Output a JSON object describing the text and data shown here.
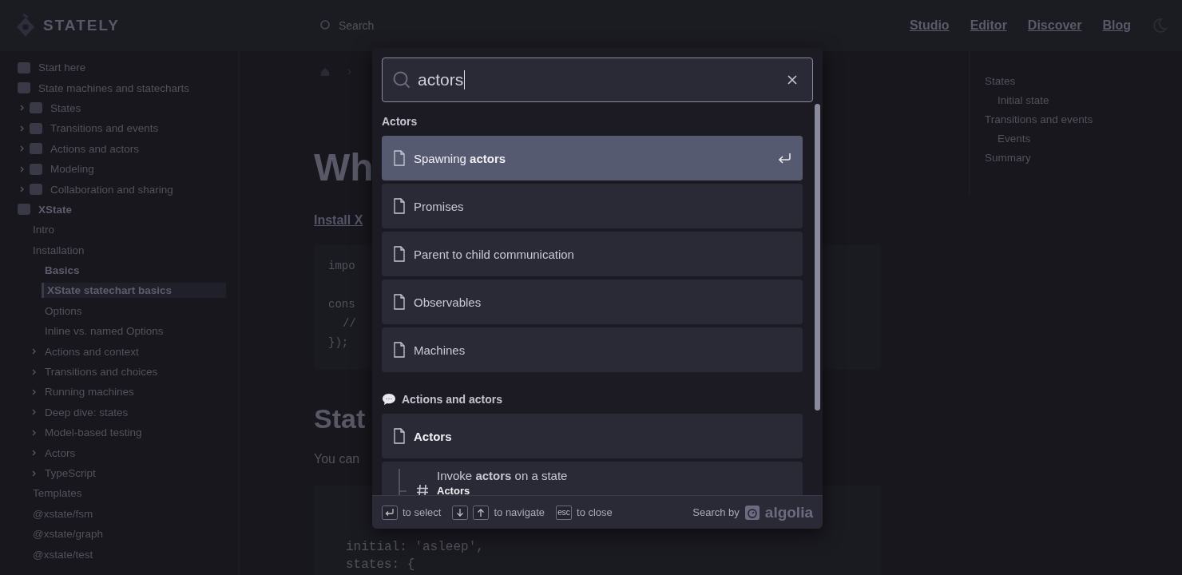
{
  "header": {
    "logo": "STATELY",
    "search_placeholder": "Search",
    "nav": [
      "Studio",
      "Editor",
      "Discover",
      "Blog"
    ]
  },
  "sidebar": {
    "items": [
      {
        "label": "Start here",
        "kind": "section",
        "selected": false
      },
      {
        "label": "State machines and statecharts",
        "kind": "section",
        "selected": false,
        "children": [
          {
            "label": "States",
            "kind": "section",
            "selected": false,
            "expanded": false
          },
          {
            "label": "Transitions and events",
            "kind": "section",
            "selected": false,
            "expanded": false
          },
          {
            "label": "Actions and actors",
            "kind": "section",
            "selected": false,
            "expanded": false
          },
          {
            "label": "Modeling",
            "kind": "section",
            "selected": false,
            "expanded": false
          },
          {
            "label": "Collaboration and sharing",
            "kind": "section",
            "selected": false,
            "expanded": false
          }
        ]
      },
      {
        "label": "XState",
        "kind": "section",
        "selected": false,
        "bold": true,
        "children": [
          {
            "label": "Intro",
            "selected": false
          },
          {
            "label": "Installation",
            "selected": false,
            "children": [
              {
                "label": "Basics",
                "selected": false,
                "bold": true
              },
              {
                "label": "XState statechart basics",
                "selected": true,
                "bold": true
              },
              {
                "label": "Options",
                "selected": false
              },
              {
                "label": "Inline vs. named Options",
                "selected": false
              },
              {
                "label": "Actions and context",
                "selected": false,
                "expanded": false
              },
              {
                "label": "Transitions and choices",
                "selected": false,
                "expanded": false
              },
              {
                "label": "Running machines",
                "selected": false,
                "expanded": false
              },
              {
                "label": "Deep dive: states",
                "selected": false,
                "expanded": false
              },
              {
                "label": "Model-based testing",
                "selected": false,
                "expanded": false
              },
              {
                "label": "Actors",
                "selected": false,
                "expanded": false
              },
              {
                "label": "TypeScript",
                "selected": false,
                "expanded": false
              }
            ]
          },
          {
            "label": "Templates",
            "selected": false
          },
          {
            "label": "@xstate/fsm",
            "selected": false
          },
          {
            "label": "@xstate/graph",
            "selected": false
          },
          {
            "label": "@xstate/test",
            "selected": false
          }
        ]
      }
    ]
  },
  "main": {
    "heading": "Wh",
    "link": "Install X",
    "code_1": [
      "impo",
      "cons",
      "//",
      "});"
    ],
    "heading_2": "Stat",
    "paragraph": "You can",
    "code_2": [
      "initial: 'asleep',",
      "states: {"
    ]
  },
  "toc": [
    {
      "label": "States",
      "children": [
        {
          "label": "Initial state"
        }
      ]
    },
    {
      "label": "Transitions and events",
      "children": [
        {
          "label": "Events"
        }
      ]
    },
    {
      "label": "Summary"
    }
  ],
  "search_modal": {
    "query": "actors",
    "sections": [
      {
        "title": "Actors",
        "hits": [
          {
            "kind": "page",
            "title": "Spawning **actors**",
            "selected": true
          },
          {
            "kind": "page",
            "title": "Promises",
            "selected": false
          },
          {
            "kind": "page",
            "title": "Parent to child communication",
            "selected": false
          },
          {
            "kind": "page",
            "title": "Observables",
            "selected": false
          },
          {
            "kind": "page",
            "title": "Machines",
            "selected": false
          }
        ]
      },
      {
        "title": "Actions and actors",
        "kind": "category",
        "hits": [
          {
            "kind": "page",
            "title": "Actors",
            "bold": true,
            "selected": false
          },
          {
            "kind": "heading",
            "title": "Invoke **actors** on a state",
            "subtitle": "Actors",
            "selected": false
          }
        ]
      }
    ],
    "footer": {
      "hints": [
        {
          "keys": [
            {
              "kind": "enter"
            }
          ],
          "label": "to select"
        },
        {
          "keys": [
            {
              "kind": "down"
            },
            {
              "kind": "up"
            }
          ],
          "label": "to navigate"
        },
        {
          "keys": [
            {
              "kind": "text",
              "text": "esc"
            }
          ],
          "label": "to close"
        }
      ],
      "search_by": "Search by",
      "brand": "algolia"
    }
  }
}
